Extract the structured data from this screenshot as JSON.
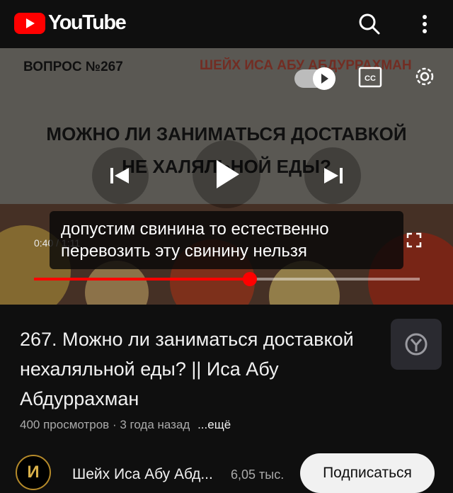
{
  "app": {
    "brand": "YouTube",
    "brand_color": "#ff0000"
  },
  "video": {
    "question_number": "ВОПРОС №267",
    "author_overlay": "ШЕЙХ ИСА АБУ АБДУРРАХМАН",
    "title_line1": "МОЖНО ЛИ ЗАНИМАТЬСЯ ДОСТАВКОЙ",
    "title_line2": "НЕ ХАЛЯЛЬНОЙ ЕДЫ?",
    "caption_line1": "допустим свинина то естественно",
    "caption_line2": "перевозить эту свинину нельзя",
    "time_display": "0:40 / 1:11",
    "progress_percent": 56,
    "autoplay_on": true
  },
  "info": {
    "title": "267. Можно ли заниматься доставкой нехаляльной еды? || Иса Абу Абдуррахман",
    "views": "400 просмотров",
    "age": "3 года назад",
    "more_label": "...ещё"
  },
  "channel": {
    "avatar_letter": "И",
    "name": "Шейх Иса Абу Абд...",
    "subscribers": "6,05 тыс.",
    "subscribe_label": "Подписаться"
  }
}
